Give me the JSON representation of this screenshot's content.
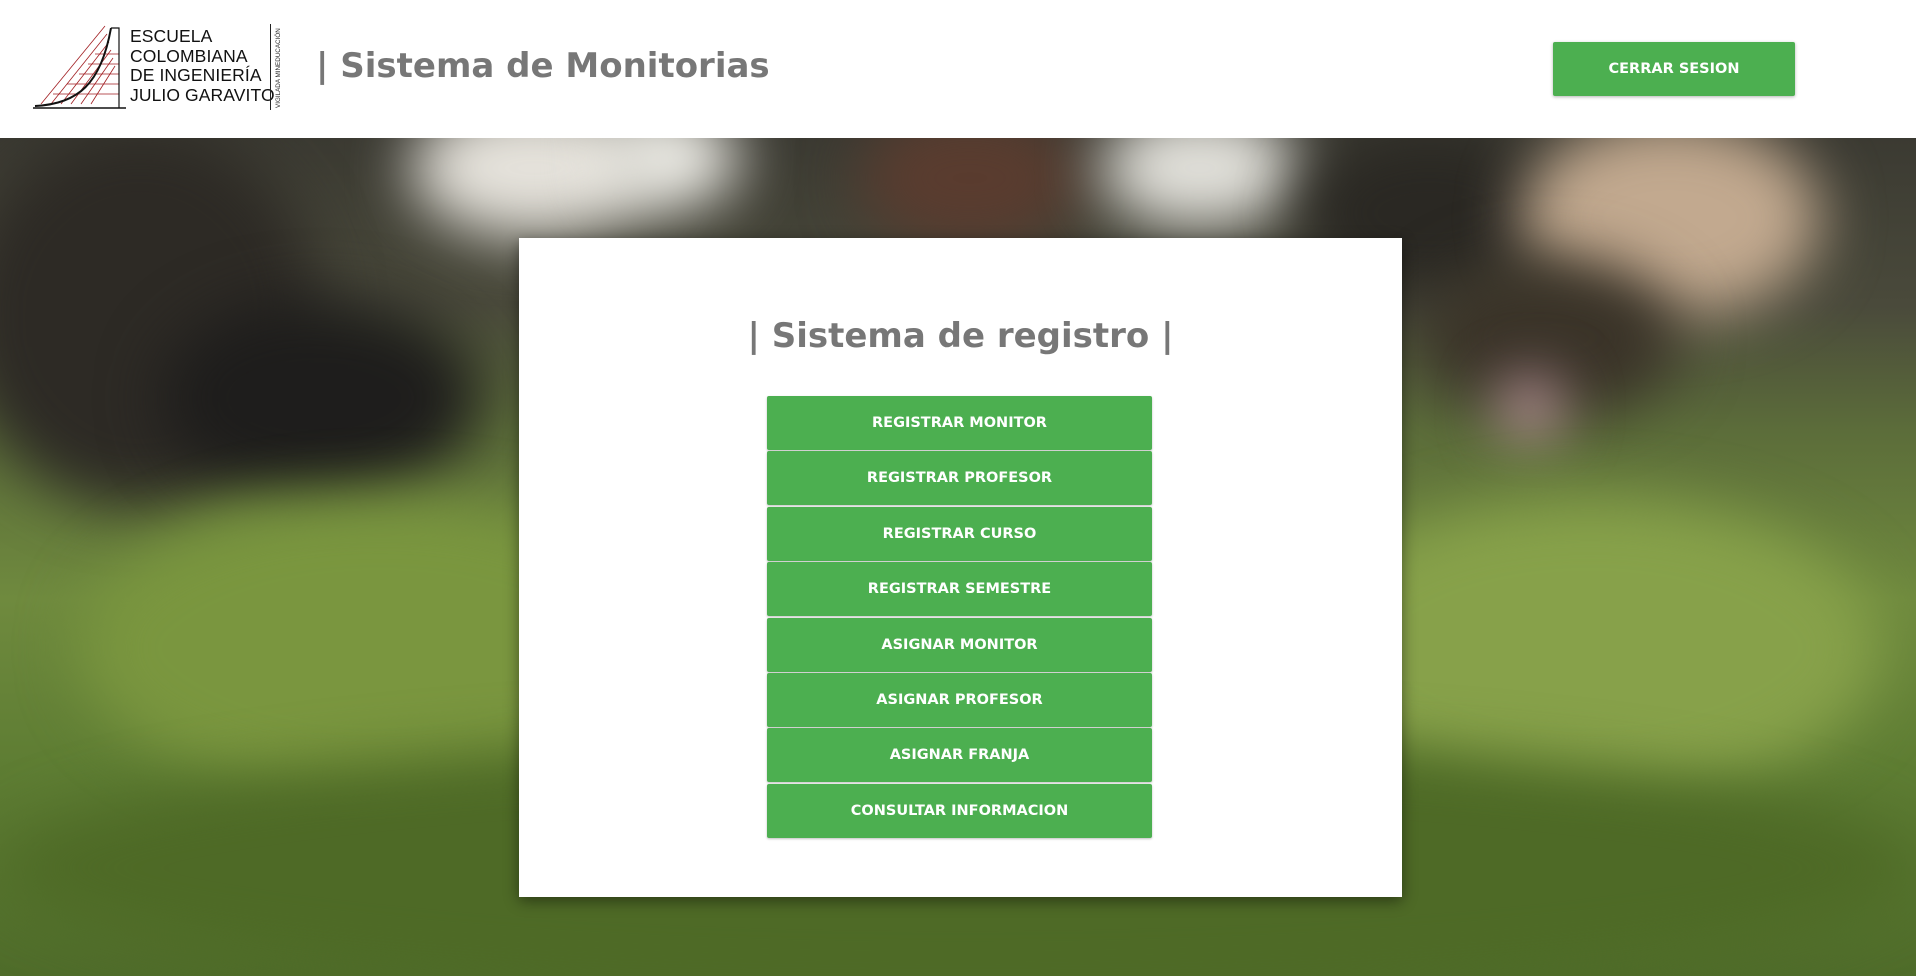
{
  "header": {
    "logo": {
      "lines": [
        "ESCUELA",
        "COLOMBIANA",
        "DE INGENIERÍA",
        "JULIO GARAVITO"
      ],
      "vertical_text": "VIGILADA MINEDUCACIÓN"
    },
    "title": "| Sistema de Monitorias",
    "logout_label": "CERRAR SESION"
  },
  "main": {
    "title": "| Sistema de registro |",
    "buttons": [
      {
        "label": "REGISTRAR MONITOR"
      },
      {
        "label": "REGISTRAR PROFESOR"
      },
      {
        "label": "REGISTRAR CURSO"
      },
      {
        "label": "REGISTRAR SEMESTRE"
      },
      {
        "label": "ASIGNAR MONITOR"
      },
      {
        "label": "ASIGNAR PROFESOR"
      },
      {
        "label": "ASIGNAR FRANJA"
      },
      {
        "label": "CONSULTAR INFORMACION"
      }
    ]
  },
  "colors": {
    "accent": "#4caf50",
    "title_gray": "#777777",
    "logo_red": "#a11d21"
  },
  "background": "blurred-grass-photo"
}
